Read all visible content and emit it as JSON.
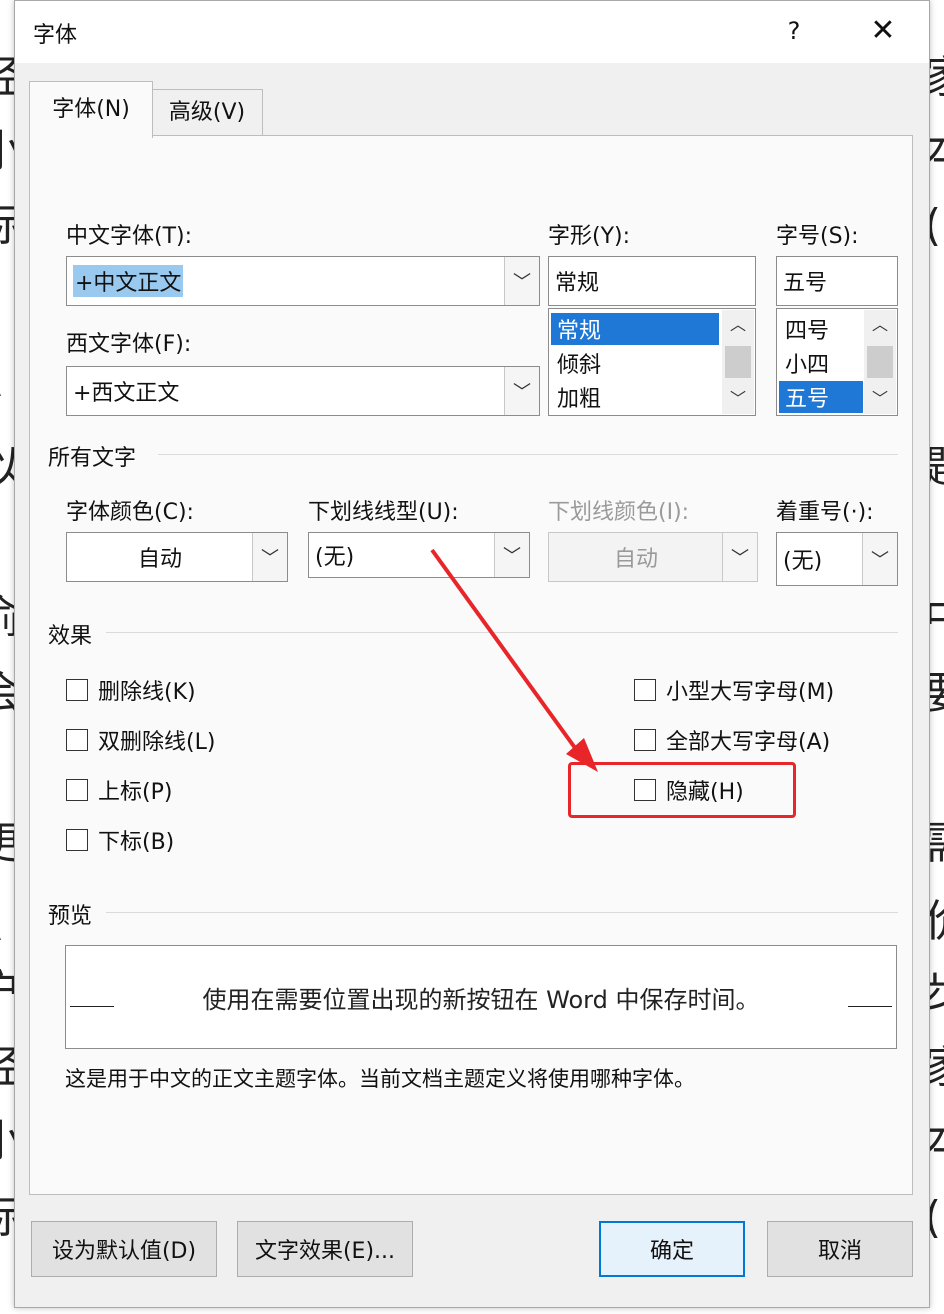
{
  "window": {
    "title": "字体",
    "help": "?",
    "close": "✕"
  },
  "tabs": [
    {
      "label": "字体(N)",
      "active": true
    },
    {
      "label": "高级(V)",
      "active": false
    }
  ],
  "font": {
    "chinese_label": "中文字体(T):",
    "chinese_value": "+中文正文",
    "western_label": "西文字体(F):",
    "western_value": "+西文正文",
    "style_label": "字形(Y):",
    "style_value": "常规",
    "style_options": [
      "常规",
      "倾斜",
      "加粗"
    ],
    "style_selected": "常规",
    "size_label": "字号(S):",
    "size_value": "五号",
    "size_options": [
      "四号",
      "小四",
      "五号"
    ],
    "size_selected": "五号"
  },
  "all_text": {
    "group_label": "所有文字",
    "color_label": "字体颜色(C):",
    "color_value": "自动",
    "underline_label": "下划线线型(U):",
    "underline_value": "(无)",
    "underline_color_label": "下划线颜色(I):",
    "underline_color_value": "自动",
    "emphasis_label": "着重号(·):",
    "emphasis_value": "(无)"
  },
  "effects": {
    "group_label": "效果",
    "strikethrough": "删除线(K)",
    "double_strikethrough": "双删除线(L)",
    "superscript": "上标(P)",
    "subscript": "下标(B)",
    "small_caps": "小型大写字母(M)",
    "all_caps": "全部大写字母(A)",
    "hidden": "隐藏(H)"
  },
  "preview": {
    "group_label": "预览",
    "sample": "使用在需要位置出现的新按钮在 Word 中保存时间。",
    "description": "这是用于中文的正文主题字体。当前文档主题定义将使用哪种字体。"
  },
  "buttons": {
    "set_default": "设为默认值(D)",
    "text_effects": "文字效果(E)...",
    "ok": "确定",
    "cancel": "取消"
  },
  "annotation": {
    "highlight_color": "#e8262a"
  },
  "background_text": [
    "经",
    "小",
    "际",
    "\\",
    "以",
    "俞",
    "会",
    "更",
    "\\",
    "户",
    "经",
    "小",
    "际",
    "家",
    "本",
    "(",
    "题",
    "中",
    "要",
    "需",
    "价",
    "步",
    "家",
    "本",
    "("
  ]
}
